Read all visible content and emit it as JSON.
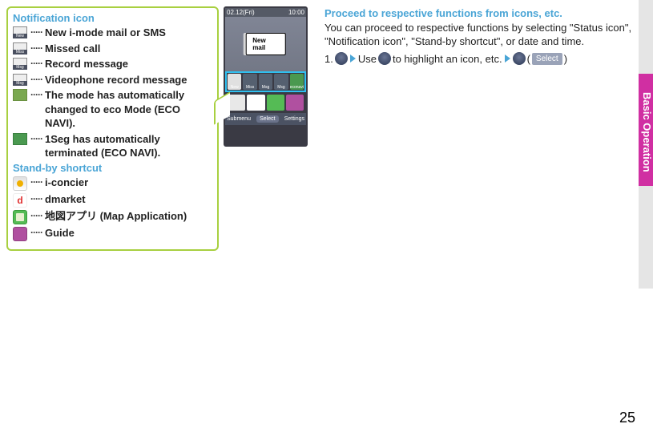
{
  "notif_head": "Notification icon",
  "notif_items": [
    {
      "label": "New",
      "desc": "New i-mode mail or SMS"
    },
    {
      "label": "Miss",
      "desc": "Missed call"
    },
    {
      "label": "Msg",
      "desc": "Record message"
    },
    {
      "label": "Msg",
      "desc": "Videophone record message"
    },
    {
      "label": "",
      "desc": "The mode has automatically changed to eco Mode (ECO NAVI)."
    },
    {
      "label": "",
      "desc": "1Seg has automatically terminated (ECO NAVI)."
    }
  ],
  "shortcut_head": "Stand-by shortcut",
  "shortcut_items": [
    {
      "cls": "ic-iconcier",
      "desc": "i-concier"
    },
    {
      "cls": "ic-dmarket",
      "desc": "dmarket"
    },
    {
      "cls": "ic-map",
      "desc": "地図アプリ (Map Application)"
    },
    {
      "cls": "ic-guide",
      "desc": "Guide"
    }
  ],
  "phone": {
    "status_date": "02.12(Fri)",
    "status_time": "10:00",
    "popup": "New mail",
    "row1": [
      "New",
      "Miss",
      "Msg",
      "Msg",
      "econavi"
    ],
    "row2": [
      "i-concier",
      "dmarket",
      "地図アプリ",
      "Guide"
    ],
    "bottom_left": "Submenu",
    "bottom_mid": "Select",
    "bottom_right": "Settings"
  },
  "right": {
    "head": "Proceed to respective functions from icons, etc.",
    "body": "You can proceed to respective functions by selecting \"Status icon\", \"Notification icon\", \"Stand-by shortcut\", or date and time.",
    "step_no": "1.",
    "step_use": "Use",
    "step_highlight": " to highlight an icon, etc.",
    "select_label": "Select"
  },
  "side_tab": "Basic Operation",
  "page_num": "25"
}
